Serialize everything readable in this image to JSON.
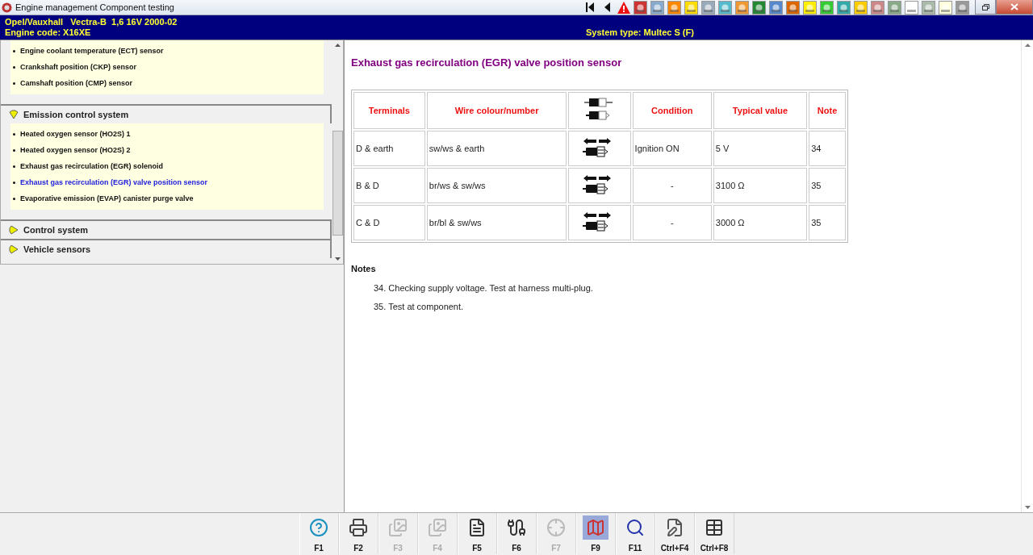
{
  "window": {
    "title": "Engine management Component testing"
  },
  "vehicle": {
    "model": "Opel/Vauxhall   Vectra-B  1,6 16V 2000-02",
    "engine_code": "Engine code: X16XE",
    "system_type": "System type: Multec S (F)"
  },
  "sidebar": {
    "sections": [
      {
        "expanded": true,
        "items": [
          {
            "label": "Engine coolant temperature (ECT) sensor",
            "selected": false
          },
          {
            "label": "Crankshaft position (CKP) sensor",
            "selected": false
          },
          {
            "label": "Camshaft position (CMP) sensor",
            "selected": false
          }
        ]
      },
      {
        "title": "Emission control system",
        "expanded": true,
        "items": [
          {
            "label": "Heated oxygen sensor (HO2S) 1",
            "selected": false
          },
          {
            "label": "Heated oxygen sensor (HO2S) 2",
            "selected": false
          },
          {
            "label": "Exhaust gas recirculation (EGR) solenoid",
            "selected": false
          },
          {
            "label": "Exhaust gas recirculation (EGR) valve position sensor",
            "selected": true
          },
          {
            "label": "Evaporative emission (EVAP) canister purge valve",
            "selected": false
          }
        ]
      },
      {
        "title": "Control system",
        "expanded": false
      },
      {
        "title": "Vehicle sensors",
        "expanded": false
      }
    ]
  },
  "content": {
    "title": "Exhaust gas recirculation (EGR) valve position sensor",
    "table": {
      "columns": [
        {
          "kind": "text",
          "label": "Terminals"
        },
        {
          "kind": "text",
          "label": "Wire colour/number"
        },
        {
          "kind": "icon"
        },
        {
          "kind": "text",
          "label": "Condition"
        },
        {
          "kind": "text",
          "label": "Typical value"
        },
        {
          "kind": "text",
          "label": "Note"
        }
      ],
      "rows": [
        {
          "cells": [
            {
              "kind": "text",
              "text": "D & earth"
            },
            {
              "kind": "text",
              "text": "sw/ws & earth"
            },
            {
              "kind": "icon"
            },
            {
              "kind": "text",
              "text": "Ignition ON"
            },
            {
              "kind": "text",
              "text": "5 V"
            },
            {
              "kind": "text",
              "text": "34"
            }
          ]
        },
        {
          "cells": [
            {
              "kind": "text",
              "text": "B & D"
            },
            {
              "kind": "text",
              "text": "br/ws & sw/ws"
            },
            {
              "kind": "icon"
            },
            {
              "kind": "center",
              "text": "-"
            },
            {
              "kind": "text",
              "text": "3100 Ω"
            },
            {
              "kind": "text",
              "text": "35"
            }
          ]
        },
        {
          "cells": [
            {
              "kind": "text",
              "text": "C & D"
            },
            {
              "kind": "text",
              "text": "br/bl & sw/ws"
            },
            {
              "kind": "icon"
            },
            {
              "kind": "center",
              "text": "-"
            },
            {
              "kind": "text",
              "text": "3000 Ω"
            },
            {
              "kind": "text",
              "text": "35"
            }
          ]
        }
      ]
    },
    "notes_heading": "Notes",
    "notes": [
      "34. Checking supply voltage. Test at harness multi-plug.",
      "35. Test at component."
    ]
  },
  "function_keys": [
    {
      "label": "F1",
      "disabled": false,
      "selected": false
    },
    {
      "label": "F2",
      "disabled": false,
      "selected": false
    },
    {
      "label": "F3",
      "disabled": true,
      "selected": false
    },
    {
      "label": "F4",
      "disabled": true,
      "selected": false
    },
    {
      "label": "F5",
      "disabled": false,
      "selected": false
    },
    {
      "label": "F6",
      "disabled": false,
      "selected": false
    },
    {
      "label": "F7",
      "disabled": true,
      "selected": false
    },
    {
      "label": "F9",
      "disabled": false,
      "selected": true
    },
    {
      "label": "F11",
      "disabled": false,
      "selected": false
    },
    {
      "label": "Ctrl+F4",
      "disabled": false,
      "selected": false
    },
    {
      "label": "Ctrl+F8",
      "disabled": false,
      "selected": false
    }
  ]
}
